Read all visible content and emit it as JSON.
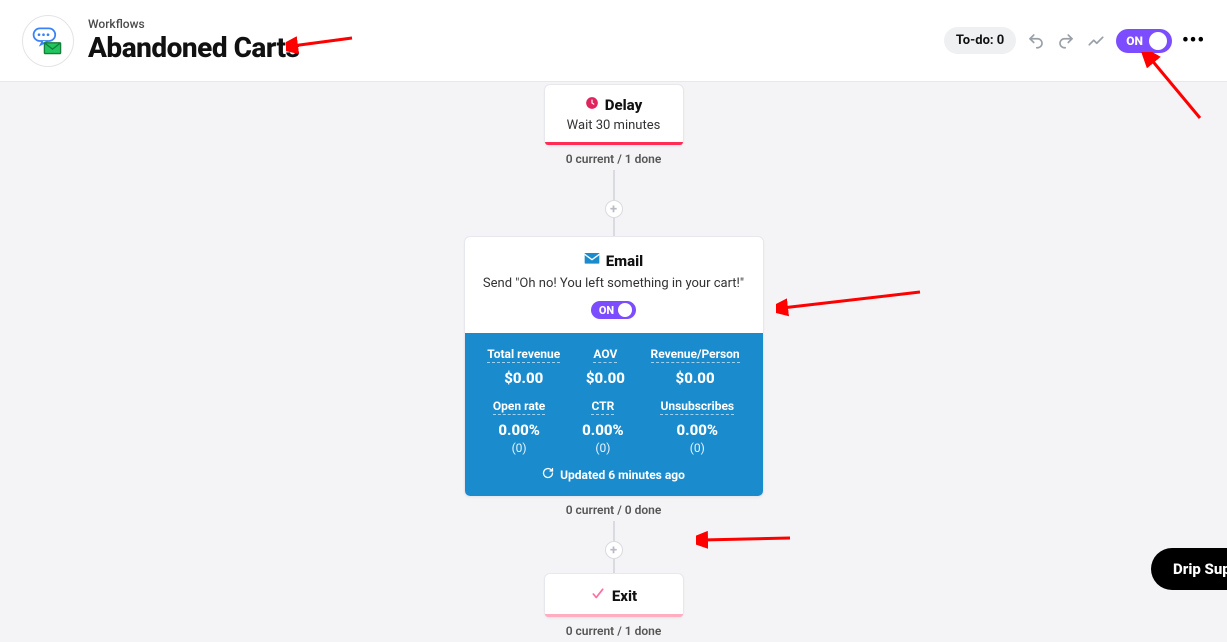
{
  "header": {
    "breadcrumb": "Workflows",
    "title": "Abandoned Carts",
    "todo_label": "To-do: 0",
    "toggle_label": "ON"
  },
  "delay": {
    "title": "Delay",
    "subtitle": "Wait 30 minutes",
    "caption": "0 current / 1 done"
  },
  "email": {
    "title": "Email",
    "subtitle": "Send \"Oh no! You left something in your cart!\"",
    "toggle_label": "ON",
    "metrics": {
      "row1": [
        {
          "label": "Total revenue",
          "value": "$0.00"
        },
        {
          "label": "AOV",
          "value": "$0.00"
        },
        {
          "label": "Revenue/Person",
          "value": "$0.00"
        }
      ],
      "row2": [
        {
          "label": "Open rate",
          "value": "0.00%",
          "count": "(0)"
        },
        {
          "label": "CTR",
          "value": "0.00%",
          "count": "(0)"
        },
        {
          "label": "Unsubscribes",
          "value": "0.00%",
          "count": "(0)"
        }
      ],
      "updated": "Updated 6 minutes ago"
    },
    "caption": "0 current / 0 done"
  },
  "exit": {
    "title": "Exit",
    "caption": "0 current / 1 done"
  },
  "footer": {
    "support_label": "Drip Support"
  }
}
